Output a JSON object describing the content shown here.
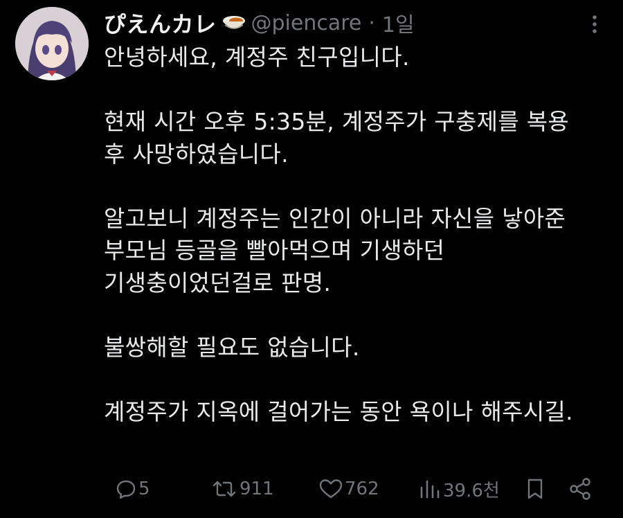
{
  "post": {
    "display_name": "ぴえんカレ",
    "handle": "@piencare",
    "separator": "·",
    "time": "1일",
    "lines": [
      "안녕하세요, 계정주 친구입니다.",
      "",
      "현재 시간 오후 5:35분, 계정주가 구충제를 복용",
      "후 사망하였습니다.",
      "",
      "알고보니 계정주는 인간이 아니라 자신을 낳아준",
      "부모님 등골을 빨아먹으며 기생하던",
      "기생충이었던걸로 판명.",
      "",
      "불쌍해할 필요도 없습니다.",
      "",
      "계정주가 지옥에 걸어가는 동안 욕이나 해주시길."
    ]
  },
  "actions": {
    "replies": "5",
    "reposts": "911",
    "likes": "762",
    "views": "39.6천"
  },
  "icons": {
    "name_emoji": "curry-rice-icon",
    "more": "more-icon",
    "reply": "reply-icon",
    "repost": "repost-icon",
    "like": "heart-icon",
    "views": "views-icon",
    "bookmark": "bookmark-icon",
    "share": "share-icon"
  },
  "colors": {
    "background": "#000000",
    "text": "#e7e9ea",
    "secondary": "#71767b"
  }
}
